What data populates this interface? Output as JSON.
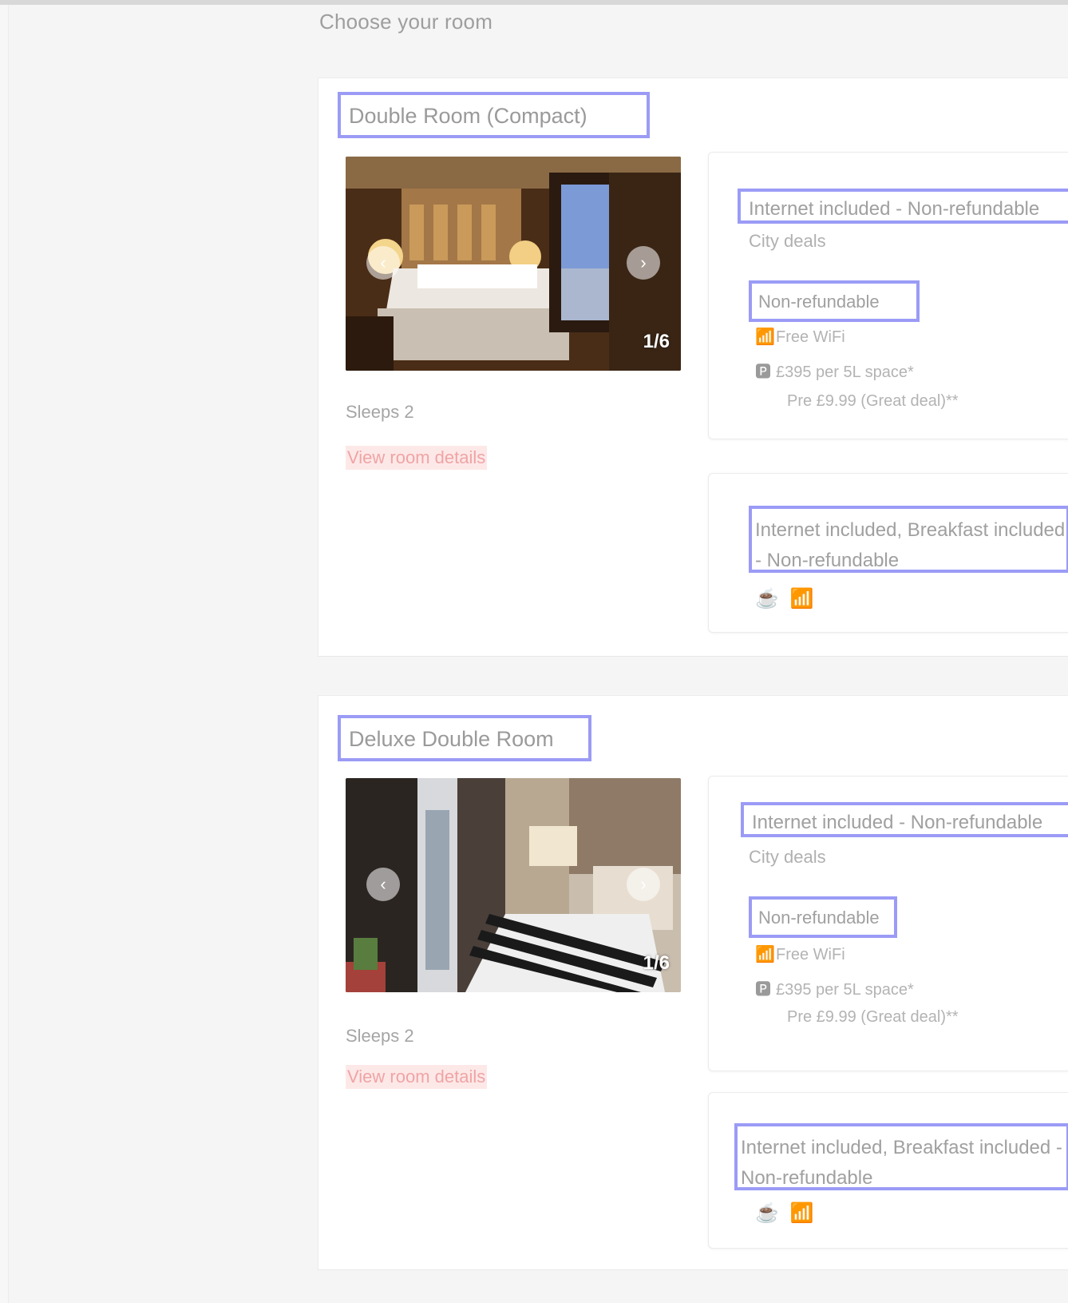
{
  "page": {
    "section_title": "Choose your room"
  },
  "rooms": [
    {
      "title": "Double Room (Compact)",
      "photo_counter": "1/6",
      "photo_prev": "‹",
      "photo_next": "›",
      "sleeps": "Sleeps 2",
      "details_link": "View room details",
      "offers": [
        {
          "title": "Internet included - Non-refundable",
          "subtitle": "City deals",
          "badge": "Non-refundable",
          "features": [
            {
              "icon": "wifi-icon",
              "glyph": "📶",
              "text": "Free WiFi"
            },
            {
              "icon": "parking-icon",
              "glyph": "🅿",
              "text": "£395 per 5L space*"
            },
            {
              "icon": "",
              "glyph": "",
              "text": "Pre £9.99 (Great deal)**"
            }
          ]
        },
        {
          "title": "Internet included, Breakfast included - Non-refundable",
          "line2": "refundable",
          "icons": [
            "☕",
            "📶"
          ]
        }
      ]
    },
    {
      "title": "Deluxe Double Room",
      "photo_counter": "1/6",
      "photo_prev": "‹",
      "photo_next": "›",
      "sleeps": "Sleeps 2",
      "details_link": "View room details",
      "offers": [
        {
          "title": "Internet included - Non-refundable",
          "subtitle": "City deals",
          "badge": "Non-refundable",
          "features": [
            {
              "icon": "wifi-icon",
              "glyph": "📶",
              "text": "Free WiFi"
            },
            {
              "icon": "parking-icon",
              "glyph": "🅿",
              "text": "£395 per 5L space*"
            },
            {
              "icon": "",
              "glyph": "",
              "text": "Pre £9.99 (Great deal)**"
            }
          ]
        },
        {
          "title": "Internet included, Breakfast included - Non-refundable",
          "line2": "refundable",
          "icons": [
            "☕",
            "📶"
          ]
        }
      ]
    }
  ]
}
